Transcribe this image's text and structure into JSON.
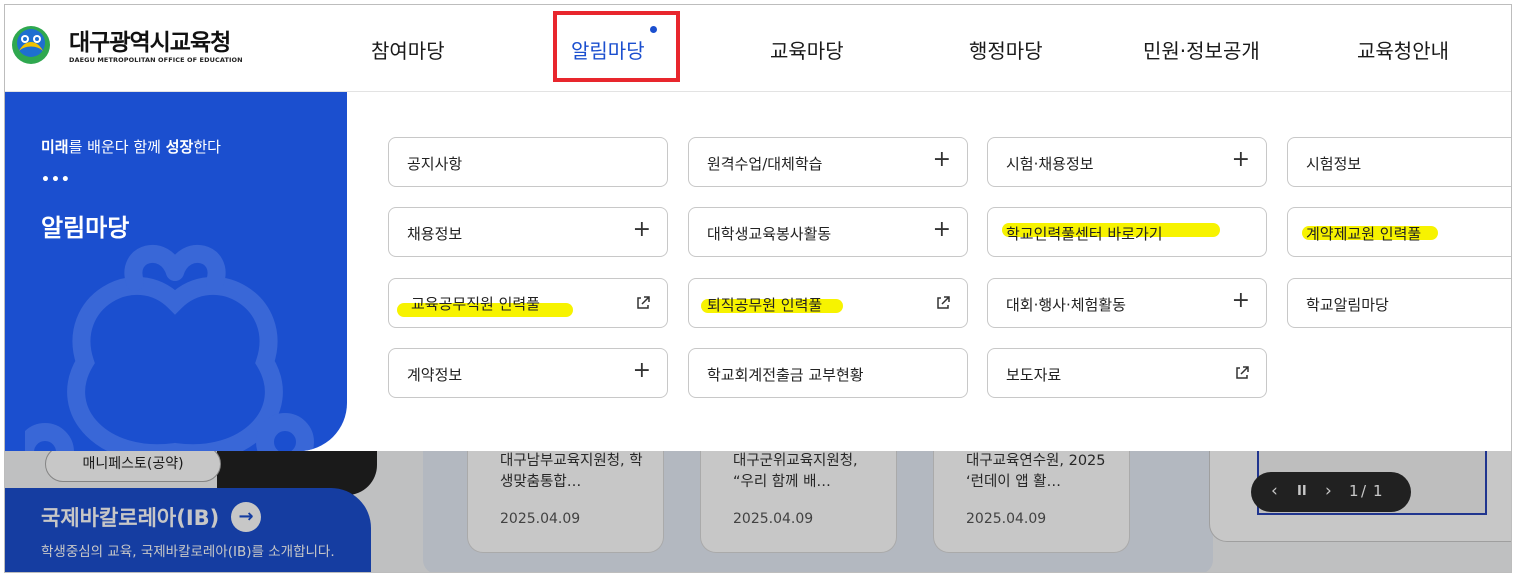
{
  "header": {
    "logo_ko": "대구광역시교육청",
    "logo_en": "DAEGU METROPOLITAN OFFICE OF EDUCATION",
    "nav": [
      {
        "label": "참여마당",
        "active": false
      },
      {
        "label": "알림마당",
        "active": true
      },
      {
        "label": "교육마당",
        "active": false
      },
      {
        "label": "행정마당",
        "active": false
      },
      {
        "label": "민원·정보공개",
        "active": false
      },
      {
        "label": "교육청안내",
        "active": false
      }
    ]
  },
  "mega": {
    "slogan_pre": "미래",
    "slogan_mid1": "를 배운다 함께 ",
    "slogan_bold": "성장",
    "slogan_end": "한다",
    "dots": "•••",
    "title": "알림마당",
    "items": [
      {
        "label": "공지사항",
        "icon": "none"
      },
      {
        "label": "원격수업/대체학습",
        "icon": "plus"
      },
      {
        "label": "시험·채용정보",
        "icon": "plus"
      },
      {
        "label": "시험정보",
        "icon": "none"
      },
      {
        "label": "채용정보",
        "icon": "plus"
      },
      {
        "label": "대학생교육봉사활동",
        "icon": "plus"
      },
      {
        "label": "학교인력풀센터 바로가기",
        "icon": "none",
        "highlighted": true
      },
      {
        "label": "계약제교원 인력풀",
        "icon": "none",
        "highlighted": true
      },
      {
        "label": "교육공무직원 인력풀",
        "icon": "external-link",
        "highlighted": true
      },
      {
        "label": "퇴직공무원 인력풀",
        "icon": "external-link",
        "highlighted": true
      },
      {
        "label": "대회·행사·체험활동",
        "icon": "plus"
      },
      {
        "label": "학교알림마당",
        "icon": "none"
      },
      {
        "label": "계약정보",
        "icon": "plus"
      },
      {
        "label": "학교회계전출금 교부현황",
        "icon": "none"
      },
      {
        "label": "보도자료",
        "icon": "external-link"
      }
    ],
    "plus_glyph": "+"
  },
  "background": {
    "manifesto": "매니페스토(공약)",
    "ib_title": "국제바칼로레아(IB)",
    "ib_arrow": "→",
    "ib_sub": "학생중심의 교육, 국제바칼로레아(IB)를 소개합니다.",
    "news": [
      {
        "title": "대구남부교육지원청, 학생맞춤통합…",
        "date": "2025.04.09"
      },
      {
        "title": "대구군위교육지원청, “우리 함께 배…",
        "date": "2025.04.09"
      },
      {
        "title": "대구교육연수원, 2025 ‘런데이 앱 활…",
        "date": "2025.04.09"
      }
    ],
    "pager": {
      "prev": "‹",
      "pause": "II",
      "next": "›",
      "current": "1",
      "sep": "/",
      "total": "1"
    }
  },
  "colors": {
    "brand_blue": "#1b4fcf",
    "highlight_red": "#e8262d",
    "marker_yellow": "#f7f300"
  }
}
